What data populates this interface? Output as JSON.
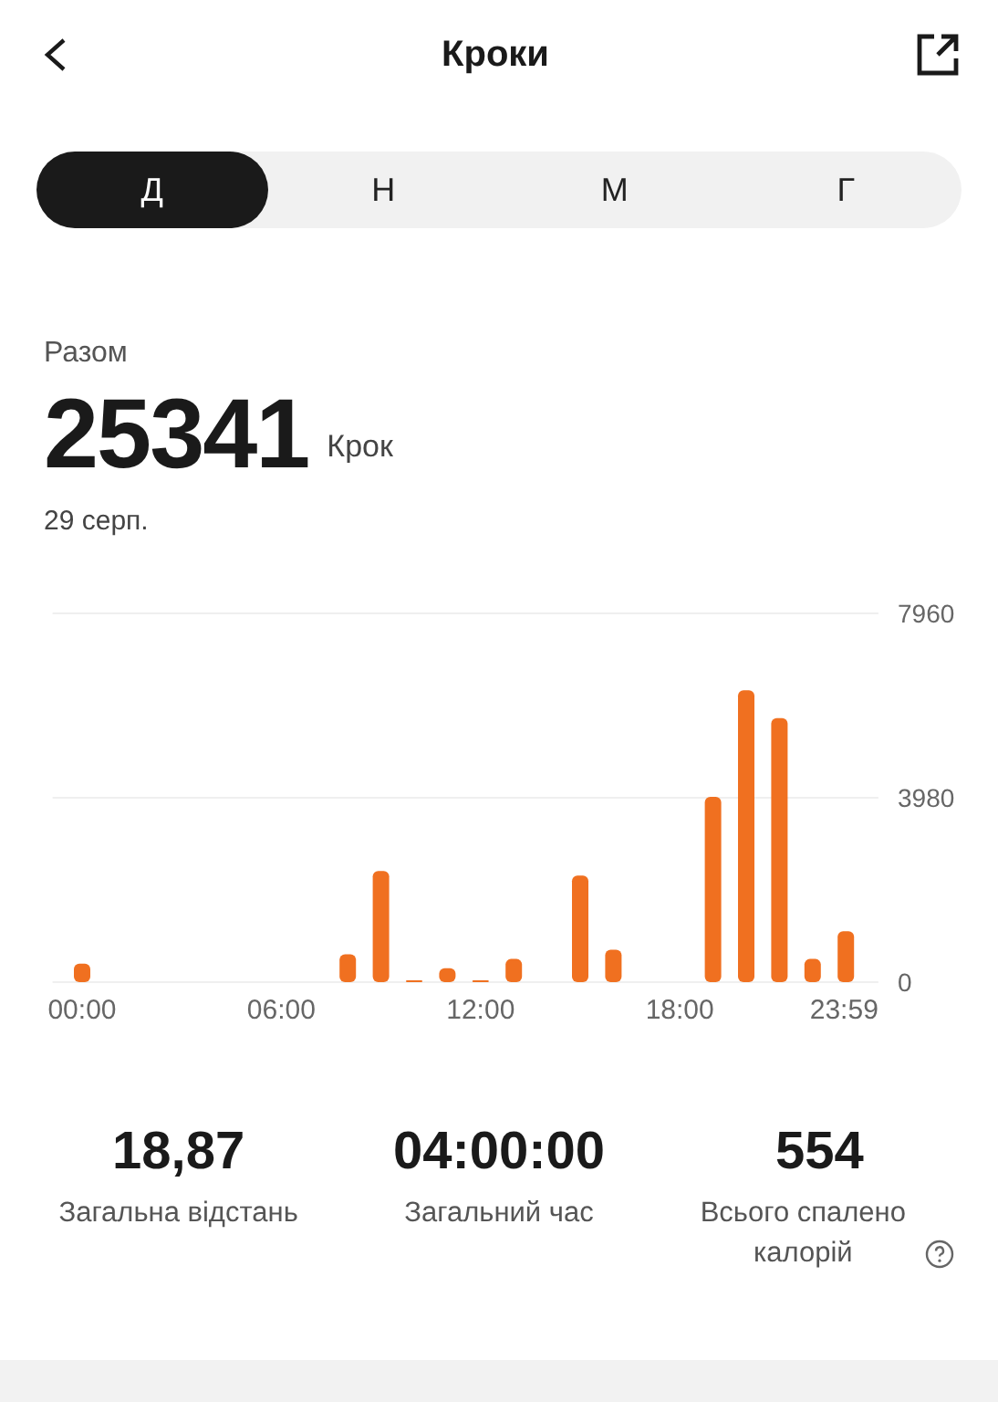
{
  "header": {
    "title": "Кроки"
  },
  "tabs": [
    {
      "label": "Д",
      "selected": true
    },
    {
      "label": "Н",
      "selected": false
    },
    {
      "label": "М",
      "selected": false
    },
    {
      "label": "Г",
      "selected": false
    }
  ],
  "summary": {
    "label": "Разом",
    "value": "25341",
    "unit": "Крок",
    "date": "29 серп."
  },
  "chart_data": {
    "type": "bar",
    "x": [
      0,
      8,
      9,
      10,
      11,
      12,
      13,
      15,
      16,
      19,
      20,
      21,
      22,
      23
    ],
    "series": [
      {
        "color": "#f07020",
        "values": [
          400,
          600,
          2400,
          20,
          300,
          10,
          500,
          2300,
          700,
          4000,
          6300,
          5700,
          500,
          1100
        ]
      }
    ],
    "xlim": [
      -1,
      23.98
    ],
    "ylim": [
      0,
      7960
    ],
    "yticks": [
      0,
      3980,
      7960
    ],
    "xticks": [
      {
        "value": 0,
        "label": "00:00"
      },
      {
        "value": 6,
        "label": "06:00"
      },
      {
        "value": 12,
        "label": "12:00"
      },
      {
        "value": 18,
        "label": "18:00"
      },
      {
        "value": 23.98,
        "label": "23:59"
      }
    ]
  },
  "stats": [
    {
      "value": "18,87",
      "label": "Загальна відстань",
      "info": false
    },
    {
      "value": "04:00:00",
      "label": "Загальний час",
      "info": false
    },
    {
      "value": "554",
      "label": "Всього спалено калорій",
      "info": true
    }
  ]
}
